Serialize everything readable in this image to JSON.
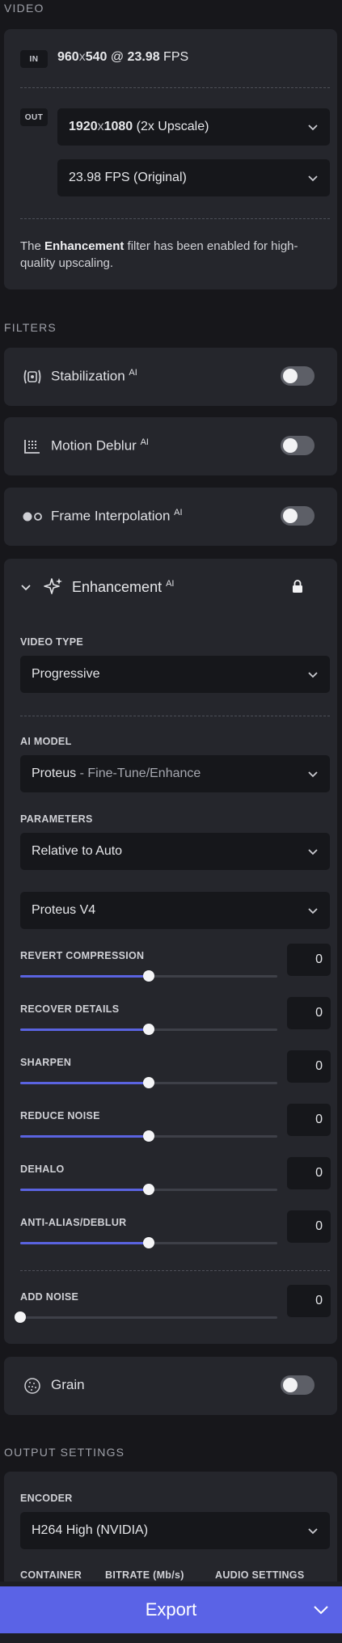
{
  "video": {
    "section_label": "VIDEO",
    "in_badge": "IN",
    "in_width": "960",
    "in_x": "x",
    "in_height": "540",
    "in_at": " @ ",
    "in_fps": "23.98",
    "in_fps_unit": " FPS",
    "out_badge": "OUT",
    "resolution_strong": "1920",
    "resolution_x": "x",
    "resolution_strong2": "1080",
    "resolution_note": " (2x Upscale)",
    "fps_select": "23.98 FPS (Original)",
    "notice_prefix": "The ",
    "notice_strong": "Enhancement",
    "notice_suffix": " filter has been enabled for high-quality upscaling."
  },
  "filters": {
    "section_label": "FILTERS",
    "stabilization": {
      "label": "Stabilization",
      "badge": "AI"
    },
    "motion_deblur": {
      "label": "Motion Deblur",
      "badge": "AI"
    },
    "frame_interpolation": {
      "label": "Frame Interpolation",
      "badge": "AI"
    },
    "enhancement": {
      "label": "Enhancement",
      "badge": "AI",
      "video_type_label": "VIDEO TYPE",
      "video_type": "Progressive",
      "ai_model_label": "AI MODEL",
      "ai_model_name": "Proteus",
      "ai_model_desc": " - Fine-Tune/Enhance",
      "parameters_label": "PARAMETERS",
      "parameters_mode": "Relative to Auto",
      "model_version": "Proteus V4",
      "params": [
        {
          "label": "REVERT COMPRESSION",
          "value": "0",
          "level": 0.5
        },
        {
          "label": "RECOVER DETAILS",
          "value": "0",
          "level": 0.5
        },
        {
          "label": "SHARPEN",
          "value": "0",
          "level": 0.5
        },
        {
          "label": "REDUCE NOISE",
          "value": "0",
          "level": 0.5
        },
        {
          "label": "DEHALO",
          "value": "0",
          "level": 0.5
        },
        {
          "label": "ANTI-ALIAS/DEBLUR",
          "value": "0",
          "level": 0.5
        }
      ],
      "add_noise": {
        "label": "ADD NOISE",
        "value": "0",
        "level": 0
      }
    },
    "grain": {
      "label": "Grain"
    }
  },
  "output": {
    "section_label": "OUTPUT SETTINGS",
    "encoder_label": "ENCODER",
    "encoder": "H264 High (NVIDIA)",
    "container_label": "CONTAINER",
    "bitrate_label": "BITRATE (Mb/s)",
    "audio_label": "AUDIO SETTINGS"
  },
  "export": {
    "label": "Export"
  },
  "colors": {
    "accent": "#5a63e6",
    "panel": "#25262c",
    "background": "#17171b"
  }
}
